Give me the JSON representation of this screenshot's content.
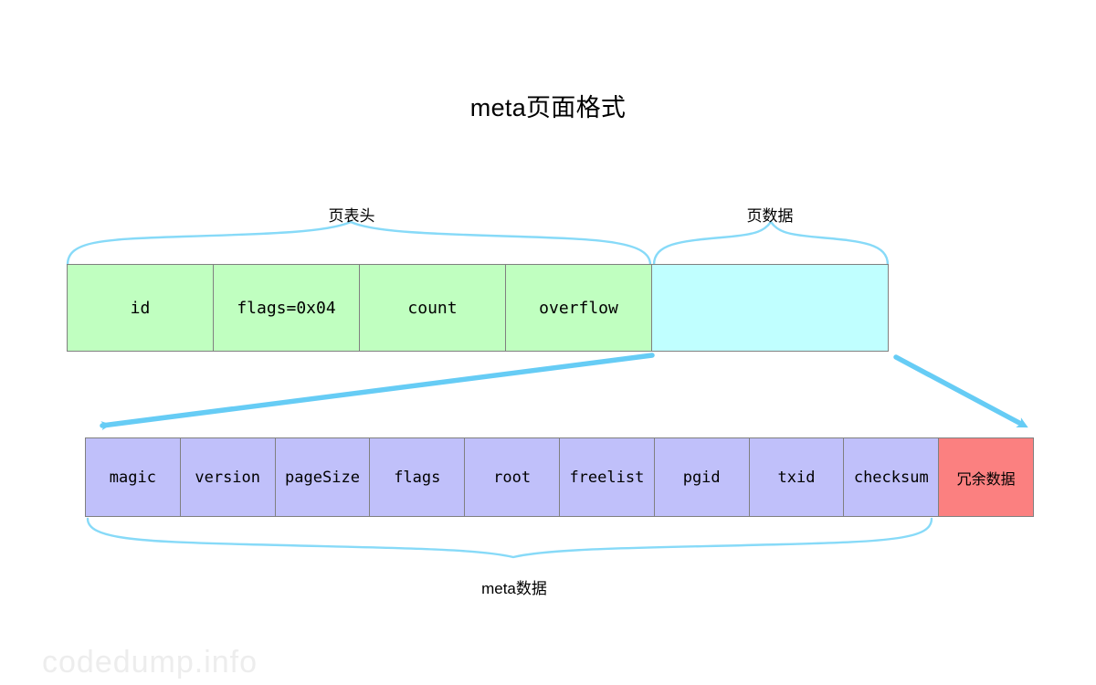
{
  "title": "meta页面格式",
  "labels": {
    "page_header": "页表头",
    "page_data": "页数据",
    "meta_data": "meta数据"
  },
  "page_row": {
    "cells": [
      {
        "label": "id",
        "kind": "header"
      },
      {
        "label": "flags=0x04",
        "kind": "header"
      },
      {
        "label": "count",
        "kind": "header"
      },
      {
        "label": "overflow",
        "kind": "header"
      },
      {
        "label": "",
        "kind": "data"
      }
    ]
  },
  "meta_row": {
    "cells": [
      {
        "label": "magic",
        "kind": "meta"
      },
      {
        "label": "version",
        "kind": "meta"
      },
      {
        "label": "pageSize",
        "kind": "meta"
      },
      {
        "label": "flags",
        "kind": "meta"
      },
      {
        "label": "root",
        "kind": "meta"
      },
      {
        "label": "freelist",
        "kind": "meta"
      },
      {
        "label": "pgid",
        "kind": "meta"
      },
      {
        "label": "txid",
        "kind": "meta"
      },
      {
        "label": "checksum",
        "kind": "meta"
      },
      {
        "label": "冗余数据",
        "kind": "redundant"
      }
    ]
  },
  "watermark": "codedump.info",
  "colors": {
    "header_cell": "#c0ffc0",
    "data_cell": "#c0ffff",
    "meta_cell": "#c0c0fa",
    "redundant_cell": "#fb8080",
    "accent": "#66ccf5",
    "border": "#808080",
    "text": "#000000",
    "watermark": "#ededed"
  }
}
